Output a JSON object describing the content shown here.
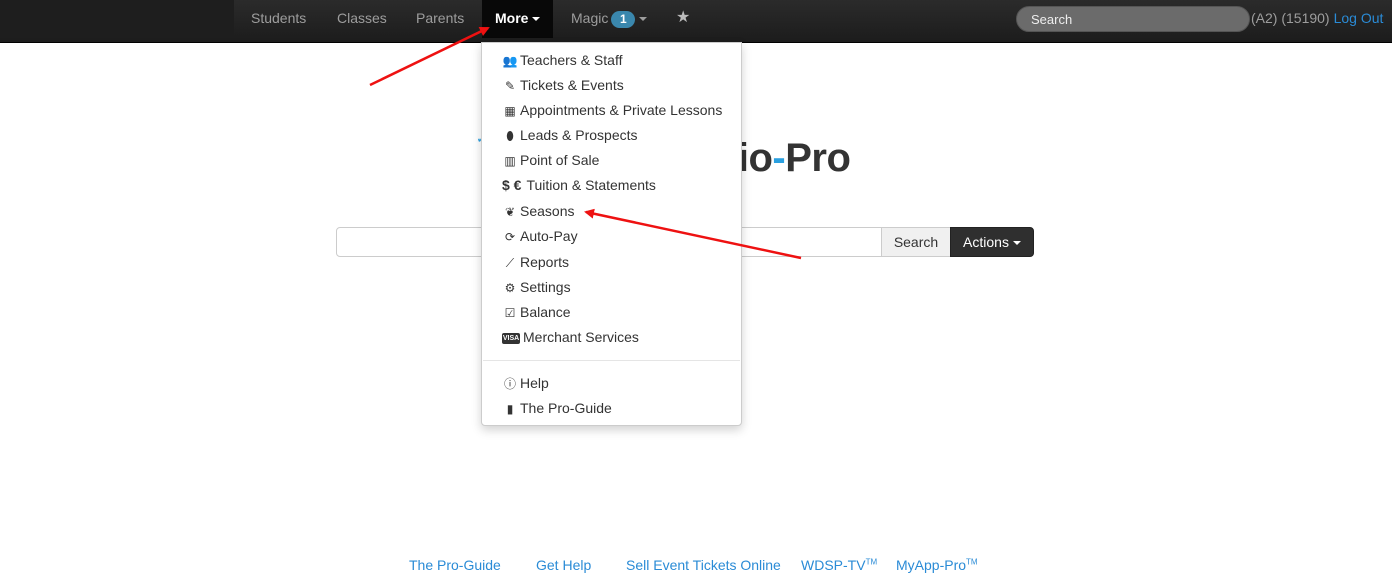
{
  "navbar": {
    "items": [
      {
        "label": "Students"
      },
      {
        "label": "Classes"
      },
      {
        "label": "Parents"
      },
      {
        "label": "More"
      },
      {
        "label": "Magic",
        "badge": "1"
      }
    ],
    "search_placeholder": "Search",
    "user_info": "(A2) (15190)",
    "logout": "Log Out"
  },
  "logo": {
    "text_a": "udio",
    "dash": "-",
    "text_b": "Pro"
  },
  "search": {
    "button": "Search",
    "actions": "Actions"
  },
  "dropdown": {
    "items": [
      {
        "label": "Teachers & Staff",
        "icon": "users-icon"
      },
      {
        "label": "Tickets & Events",
        "icon": "ticket-icon"
      },
      {
        "label": "Appointments & Private Lessons",
        "icon": "calendar-icon"
      },
      {
        "label": "Leads & Prospects",
        "icon": "map-marker-icon"
      },
      {
        "label": "Point of Sale",
        "icon": "barcode-icon"
      },
      {
        "label": "Tuition & Statements",
        "icon": "dollar-euro-icon"
      },
      {
        "label": "Seasons",
        "icon": "leaf-icon"
      },
      {
        "label": "Auto-Pay",
        "icon": "refresh-icon"
      },
      {
        "label": "Reports",
        "icon": "line-chart-icon"
      },
      {
        "label": "Settings",
        "icon": "gears-icon"
      },
      {
        "label": "Balance",
        "icon": "check-square-icon"
      },
      {
        "label": "Merchant Services",
        "icon": "visa-card-icon"
      }
    ],
    "help_items": [
      {
        "label": "Help",
        "icon": "info-circle-icon"
      },
      {
        "label": "The Pro-Guide",
        "icon": "book-icon"
      }
    ]
  },
  "footer": {
    "links": [
      {
        "label": "The Pro-Guide"
      },
      {
        "label": "Get Help"
      },
      {
        "label": "Sell Event Tickets Online"
      },
      {
        "label": "WDSP-TV",
        "sup": "TM"
      },
      {
        "label": "MyApp-Pro",
        "sup": "TM"
      }
    ]
  },
  "colors": {
    "navbar_bg": "#222222",
    "link": "#2a8bd6",
    "badge": "#3a87ad",
    "annotation_arrow": "#ee1111"
  }
}
